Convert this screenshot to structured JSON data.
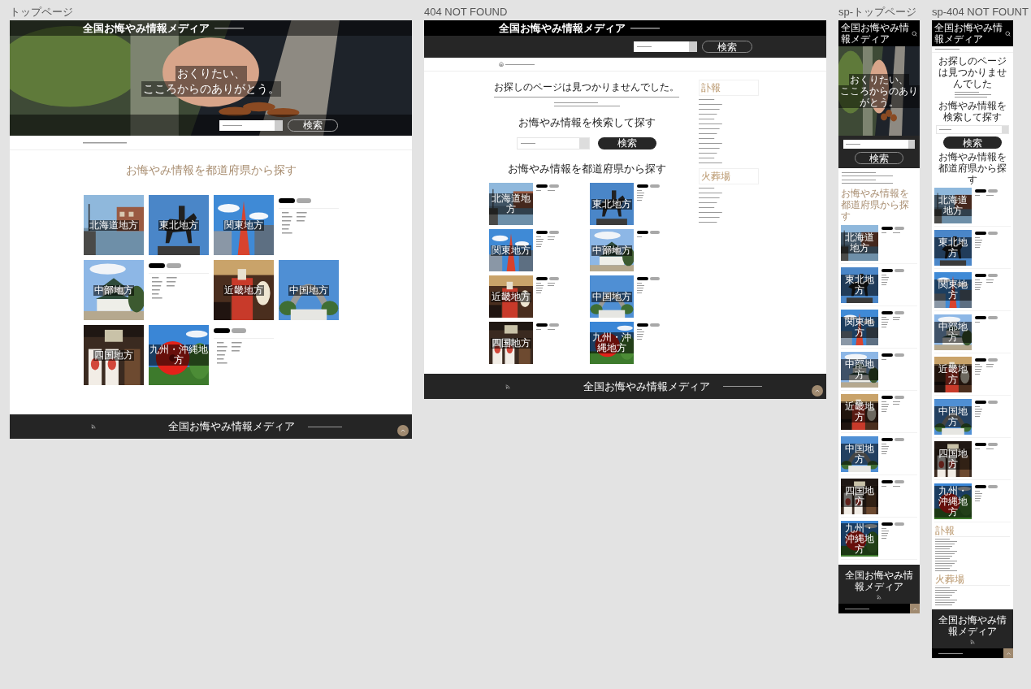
{
  "top_page": {
    "label": "トップページ",
    "site_title": "全国お悔やみ情報メディア",
    "catch_lines": [
      "おくりたい、",
      "こころからのありがとう。"
    ],
    "search_button": "検索",
    "section_heading": "お悔やみ情報を都道府県から探す",
    "tiles": [
      {
        "name": "北海道地方"
      },
      {
        "name": "東北地方"
      },
      {
        "name": "関東地方"
      },
      {
        "kind": "info"
      },
      {
        "name": "中部地方"
      },
      {
        "kind": "info"
      },
      {
        "name": "近畿地方"
      },
      {
        "name": "中国地方"
      },
      {
        "name": "四国地方"
      },
      {
        "name": "九州・沖縄地方"
      },
      {
        "kind": "info"
      }
    ],
    "footer_title": "全国お悔やみ情報メディア"
  },
  "not_found_page": {
    "label": "404 NOT FOUND",
    "site_title": "全国お悔やみ情報メディア",
    "header_search_button": "検索",
    "heading": "お探しのページは見つかりませんでした。",
    "search_heading": "お悔やみ情報を検索して探す",
    "search_button": "検索",
    "regions_heading": "お悔やみ情報を都道府県から探す",
    "regions": [
      "北海道地方",
      "東北地方",
      "関東地方",
      "中部地方",
      "近畿地方",
      "中国地方",
      "四国地方",
      "九州・沖縄地方"
    ],
    "sidebar": [
      {
        "heading": "訃報"
      },
      {
        "heading": "火葬場"
      }
    ],
    "footer_title": "全国お悔やみ情報メディア"
  },
  "sp_top_page": {
    "label": "sp-トップページ",
    "site_title": "全国お悔やみ情報メディア",
    "catch_lines": [
      "おくりたい、",
      "こころからのありがとう。"
    ],
    "search_button": "検索",
    "regions_heading": "お悔やみ情報を都道府県から探す",
    "regions": [
      "北海道地方",
      "東北地方",
      "関東地方",
      "中部地方",
      "近畿地方",
      "中国地方",
      "四国地方",
      "九州・沖縄地方"
    ],
    "footer_title": "全国お悔やみ情報メディア"
  },
  "sp_not_found_page": {
    "label": "sp-404 NOT FOUNT",
    "site_title": "全国お悔やみ情報メディア",
    "heading": "お探しのページは見つかりませんでした",
    "search_heading": "お悔やみ情報を検索して探す",
    "search_button": "検索",
    "regions_heading": "お悔やみ情報を都道府県から探す",
    "regions": [
      "北海道地方",
      "東北地方",
      "関東地方",
      "中部地方",
      "近畿地方",
      "中国地方",
      "四国地方",
      "九州・沖縄地方"
    ],
    "sidebar": [
      {
        "heading": "訃報"
      },
      {
        "heading": "火葬場"
      }
    ],
    "footer_title": "全国お悔やみ情報メディア"
  }
}
